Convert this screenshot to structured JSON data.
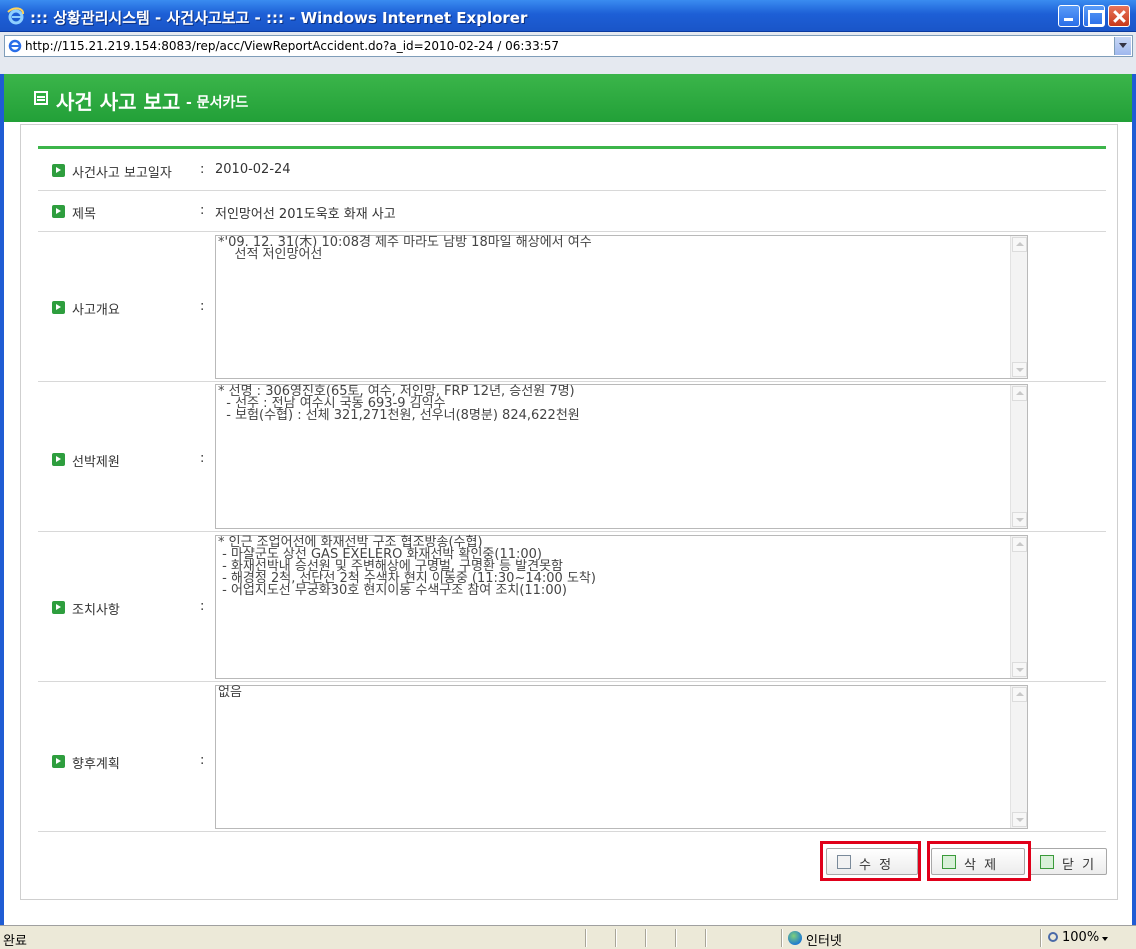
{
  "window": {
    "title": "::: 상황관리시스템 - 사건사고보고 - ::: - Windows Internet Explorer",
    "url": "http://115.21.219.154:8083/rep/acc/ViewReportAccident.do?a_id=2010-02-24 / 06:33:57"
  },
  "header": {
    "title": "사건 사고 보고",
    "subtitle": "- 문서카드"
  },
  "fields": {
    "report_date": {
      "label": "사건사고 보고일자",
      "colon": ":",
      "value": "2010-02-24"
    },
    "subject": {
      "label": "제목",
      "colon": ":",
      "value": "저인망어선 201도욱호 화재 사고"
    },
    "summary": {
      "label": "사고개요",
      "colon": ":",
      "text": "*'09. 12. 31(木) 10:08경 제주 마라도 남방 18마일 해상에서 여수\n    선적 저인망어선"
    },
    "vessel": {
      "label": "선박제원",
      "colon": ":",
      "text": "* 선명 : 306영진호(65토, 여수, 저인망, FRP 12년, 승선원 7명)\n  - 선주 : 전남 여수시 국동 693-9 김익수\n  - 보험(수협) : 선체 321,271천원, 선우너(8명분) 824,622천원"
    },
    "actions": {
      "label": "조치사항",
      "colon": ":",
      "text": "* 인근 조업어선에 화재선박 구조 협조방송(수협)\n - 마샬군도 상선 GAS EXELERO 화재선박 확인중(11:00)\n - 화재선박내 승선원 및 주변해상에 구명벌, 구명환 등 발견못함\n - 해경정 2척, 선단선 2척 수색차 현지 이동중 (11:30~14:00 도착)\n - 어업지도선 무궁화30호 현지이동 수색구조 참여 조치(11:00)"
    },
    "plan": {
      "label": "향후계획",
      "colon": ":",
      "text": "없음"
    }
  },
  "buttons": {
    "edit": "수 정",
    "delete": "삭 제",
    "close": "닫 기"
  },
  "statusbar": {
    "status": "완료",
    "zone": "인터넷",
    "zoom": "100%"
  },
  "colors": {
    "header_green": "#22a038",
    "accent_red": "#e0001a",
    "titlebar_blue": "#1d5fd6"
  }
}
